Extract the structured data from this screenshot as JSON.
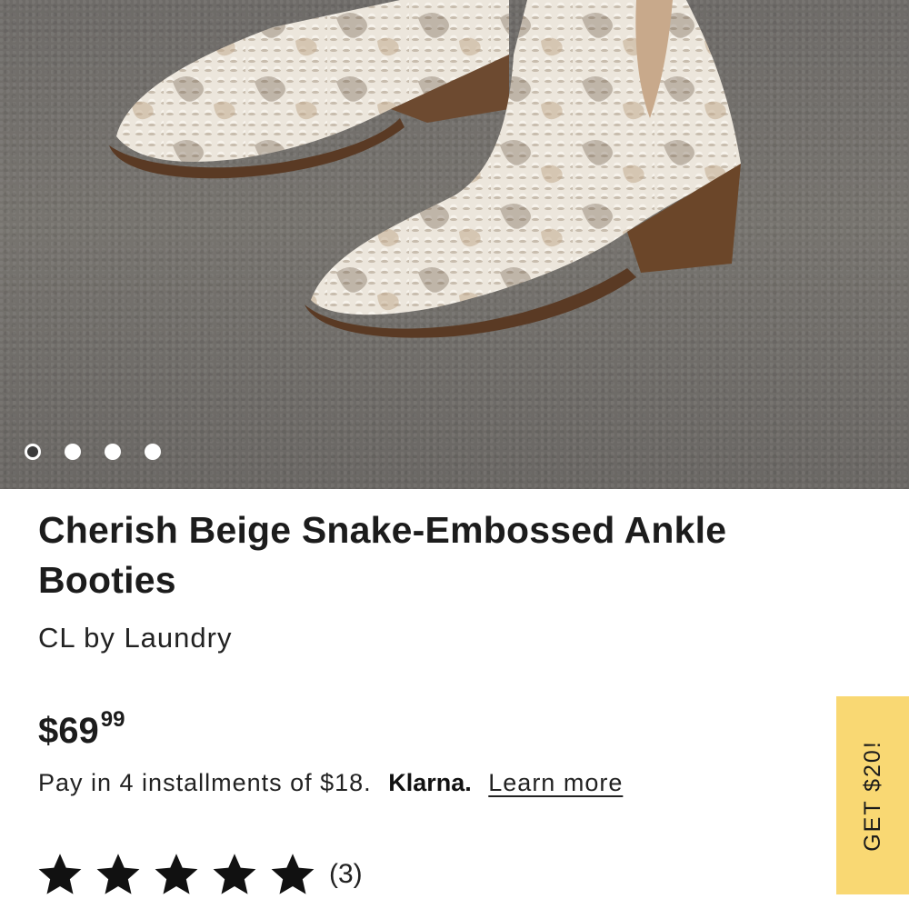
{
  "product": {
    "title": "Cherish Beige Snake-Embossed Ankle Booties",
    "brand": "CL by Laundry",
    "price_dollars": "$69",
    "price_cents": "99",
    "rating_stars": 5,
    "review_count": "(3)"
  },
  "gallery": {
    "total_images": 4,
    "current_index": 1
  },
  "klarna": {
    "text": "Pay in 4 installments of $18.",
    "logo": "Klarna.",
    "link": "Learn more"
  },
  "promo": {
    "label": "GET $20!",
    "color": "#f9d873"
  },
  "icons": {
    "star": "star-icon"
  }
}
